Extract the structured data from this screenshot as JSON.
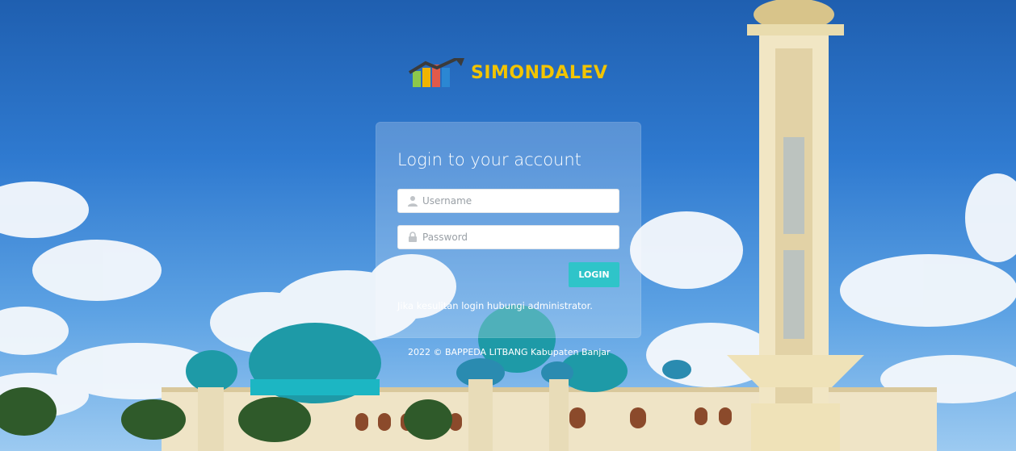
{
  "brand": {
    "title": "SIMONDALEV",
    "logo_icon": "bar-chart-trend-icon"
  },
  "login": {
    "title": "Login to your account",
    "username": {
      "placeholder": "Username",
      "value": "",
      "icon": "user-icon"
    },
    "password": {
      "placeholder": "Password",
      "value": "",
      "icon": "lock-icon"
    },
    "submit_label": "LOGIN",
    "help_text": "Jika kesulitan login hubungi administrator."
  },
  "footer": {
    "text": "2022 © BAPPEDA LITBANG Kabupaten Banjar"
  },
  "colors": {
    "brand_text": "#f2c400",
    "button": "#2fc4c9",
    "sky": "#2f7ad0"
  },
  "background": {
    "scene": "mosque-sky-photo"
  }
}
